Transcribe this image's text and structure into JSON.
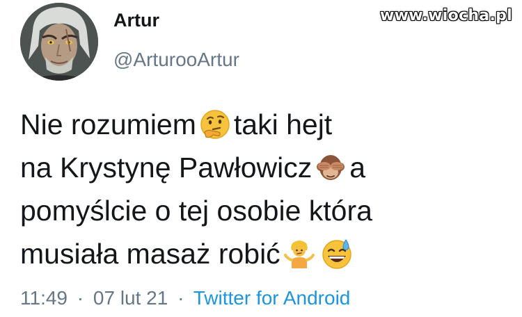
{
  "author": {
    "display_name": "Artur",
    "handle": "@ArturooArtur"
  },
  "watermark": "www.wiocha.pl",
  "tweet": {
    "line1": {
      "before": "Nie rozumiem",
      "emoji": "thinking-face-icon",
      "after": "taki hejt"
    },
    "line2": {
      "before": "na Krystynę Pawłowicz",
      "emoji": "see-no-evil-monkey-icon",
      "after": "a"
    },
    "line3": {
      "text": "pomyślcie o tej osobie która"
    },
    "line4": {
      "before": "musiała masaż robić",
      "emoji1": "person-shrugging-icon",
      "emoji2": "grinning-sweat-face-icon"
    }
  },
  "meta": {
    "time": "11:49",
    "separator": "·",
    "date": "07 lut 21",
    "source": "Twitter for Android"
  },
  "colors": {
    "text": "#14171a",
    "secondary": "#657786",
    "link": "#1b95e0"
  }
}
